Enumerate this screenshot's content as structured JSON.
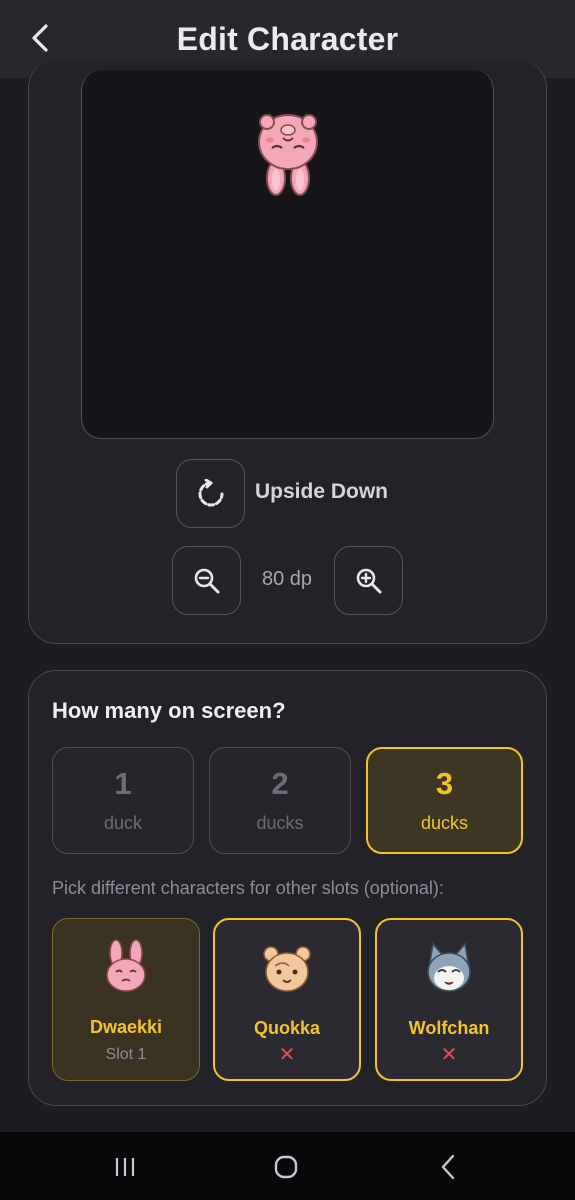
{
  "header": {
    "title": "Edit Character",
    "back_icon": "chevron-left-icon"
  },
  "editor": {
    "orientation_label": "Upside Down",
    "orientation_icon": "rotate-icon",
    "size_value": "80 dp",
    "zoom_out_icon": "zoom-out-icon",
    "zoom_in_icon": "zoom-in-icon"
  },
  "count_section": {
    "title": "How many on screen?",
    "options": [
      {
        "number": "1",
        "unit": "duck",
        "selected": false
      },
      {
        "number": "2",
        "unit": "ducks",
        "selected": false
      },
      {
        "number": "3",
        "unit": "ducks",
        "selected": true
      }
    ],
    "hint": "Pick different characters for other slots (optional):"
  },
  "slots": [
    {
      "name": "Dwaekki",
      "sub": "Slot 1"
    },
    {
      "name": "Quokka",
      "sub": "✕"
    },
    {
      "name": "Wolfchan",
      "sub": "✕"
    }
  ],
  "colors": {
    "accent": "#f4c32a",
    "remove": "#e2504f",
    "background": "#1c1c21"
  },
  "system_nav": {
    "recents_icon": "recents-icon",
    "home_icon": "home-icon",
    "back_icon": "back-icon"
  }
}
